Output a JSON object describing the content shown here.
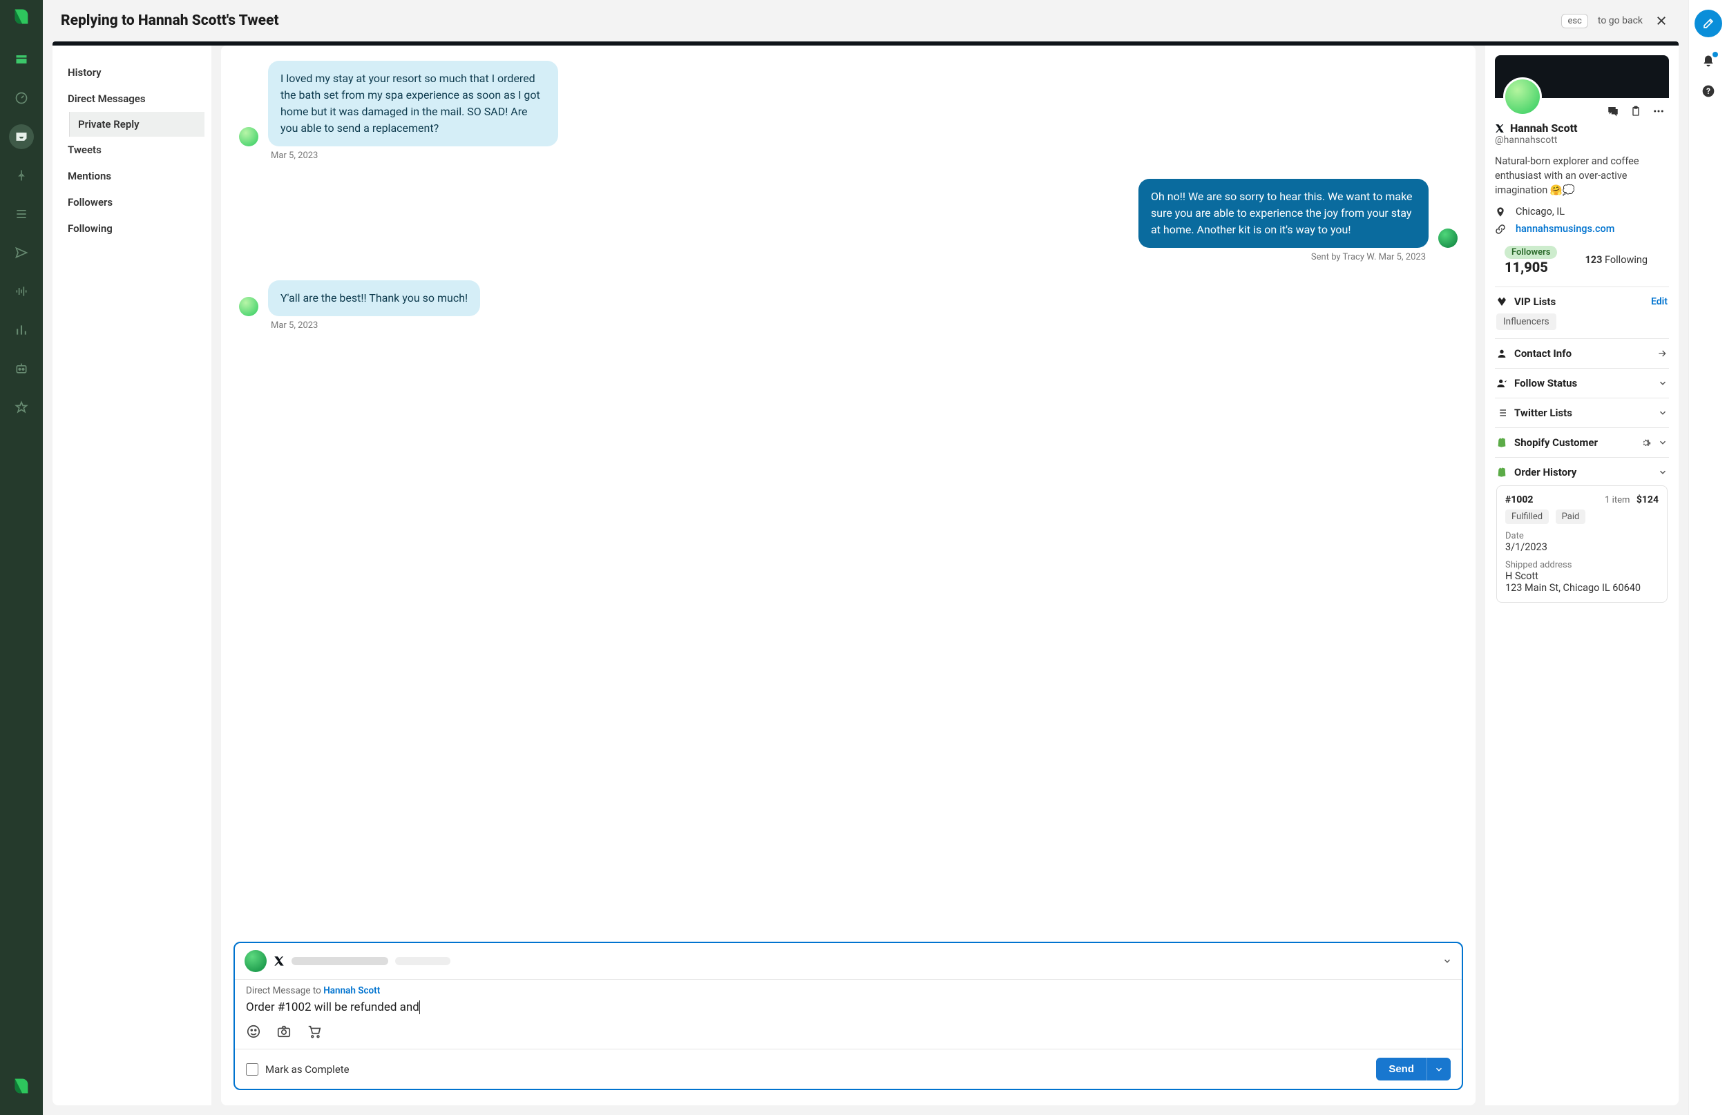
{
  "header": {
    "title": "Replying to Hannah Scott's Tweet",
    "esc_label": "esc",
    "go_back": "to go back"
  },
  "leftnav": {
    "items": [
      "History",
      "Direct Messages",
      "Tweets",
      "Mentions",
      "Followers",
      "Following"
    ],
    "subitem": "Private Reply"
  },
  "thread": {
    "msg1": {
      "text": "I loved my stay at your resort so much that I ordered the bath set from my spa experience as soon as I got home but it was damaged in the mail. SO SAD! Are you able to send a replacement?",
      "date": "Mar 5, 2023"
    },
    "msg2": {
      "text": "Oh no!! We are so sorry to hear this. We want to make sure you are able to experience the joy from your stay at home. Another kit is on it's way to you!",
      "meta": "Sent by Tracy W. Mar 5, 2023"
    },
    "msg3": {
      "text": "Y'all are the best!! Thank you so much!",
      "date": "Mar 5, 2023"
    }
  },
  "composer": {
    "context_prefix": "Direct Message to ",
    "context_name": "Hannah Scott",
    "draft": "Order #1002 will be refunded and",
    "mark_complete": "Mark as Complete",
    "send": "Send"
  },
  "profile": {
    "name": "Hannah Scott",
    "handle": "@hannahscott",
    "bio": "Natural-born explorer and coffee enthusiast with an over-active imagination 🤗💭",
    "location": "Chicago, IL",
    "website": "hannahsmusings.com",
    "followers_label": "Followers",
    "followers_count": "11,905",
    "following_count": "123",
    "following_label": "Following"
  },
  "sections": {
    "vip_title": "VIP Lists",
    "vip_edit": "Edit",
    "vip_tag": "Influencers",
    "contact": "Contact Info",
    "follow": "Follow Status",
    "twitter_lists": "Twitter Lists",
    "shopify": "Shopify Customer",
    "order_history": "Order History"
  },
  "order": {
    "id": "#1002",
    "items": "1 item",
    "price": "$124",
    "status1": "Fulfilled",
    "status2": "Paid",
    "date_label": "Date",
    "date": "3/1/2023",
    "ship_label": "Shipped address",
    "ship_name": "H Scott",
    "ship_addr": "123 Main St, Chicago IL 60640"
  }
}
